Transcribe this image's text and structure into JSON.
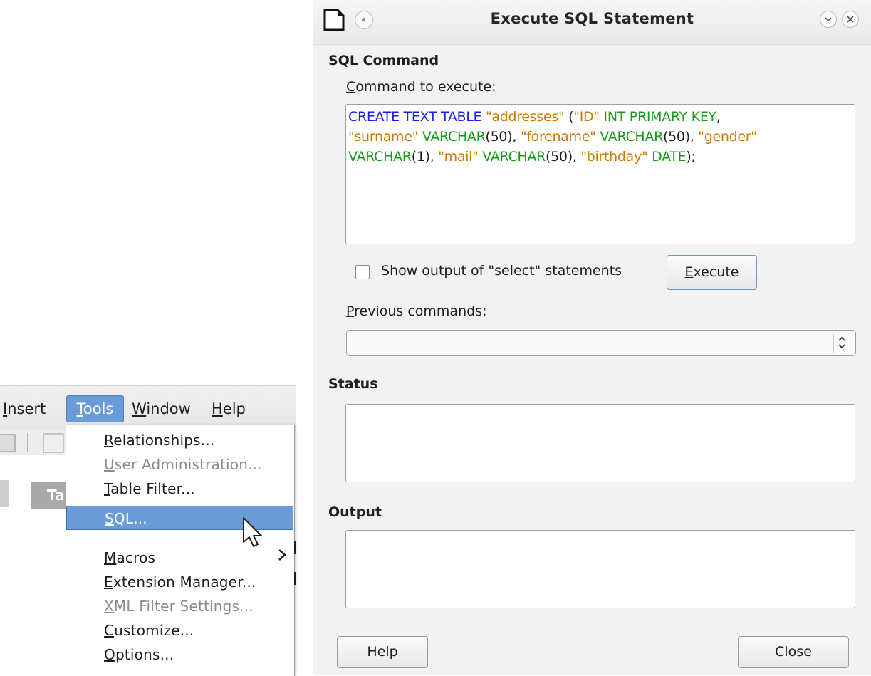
{
  "menubar": {
    "items": [
      "Insert",
      "Tools",
      "Window",
      "Help"
    ]
  },
  "tools_menu": {
    "items": [
      {
        "label": "Relationships...",
        "enabled": true
      },
      {
        "label": "User Administration...",
        "enabled": false
      },
      {
        "label": "Table Filter...",
        "enabled": true
      },
      {
        "label": "SQL...",
        "enabled": true,
        "highlighted": true
      },
      {
        "label": "Macros",
        "enabled": true,
        "submenu": true
      },
      {
        "label": "Extension Manager...",
        "enabled": true
      },
      {
        "label": "XML Filter Settings...",
        "enabled": false
      },
      {
        "label": "Customize...",
        "enabled": true
      },
      {
        "label": "Options...",
        "enabled": true
      }
    ]
  },
  "left_panel": {
    "header_fragment": "Ta"
  },
  "dialog": {
    "title": "Execute SQL Statement",
    "sql_section": "SQL Command",
    "command_label": "Command to execute:",
    "command_text": "CREATE TEXT TABLE \"addresses\" (\"ID\" INT PRIMARY KEY, \"surname\" VARCHAR(50), \"forename\" VARCHAR(50), \"gender\" VARCHAR(1), \"mail\" VARCHAR(50), \"birthday\" DATE);",
    "show_output_label": "Show output of \"select\" statements",
    "show_output_checked": false,
    "execute_button": "Execute",
    "previous_label": "Previous commands:",
    "previous_value": "",
    "status_section": "Status",
    "status_text": "",
    "output_section": "Output",
    "output_text": "",
    "help_button": "Help",
    "close_button": "Close"
  },
  "colors": {
    "highlight": "#6b9bd6",
    "sql_keyword": "#1e1ee6",
    "sql_string": "#cc7a00",
    "sql_identifier": "#1a9a1a"
  },
  "icons": [
    "save-icon",
    "document-icon",
    "chevron-right-icon",
    "mouse-cursor-icon",
    "app-icon",
    "pin-icon",
    "minimize-icon",
    "close-icon",
    "updown-arrow-icon"
  ]
}
